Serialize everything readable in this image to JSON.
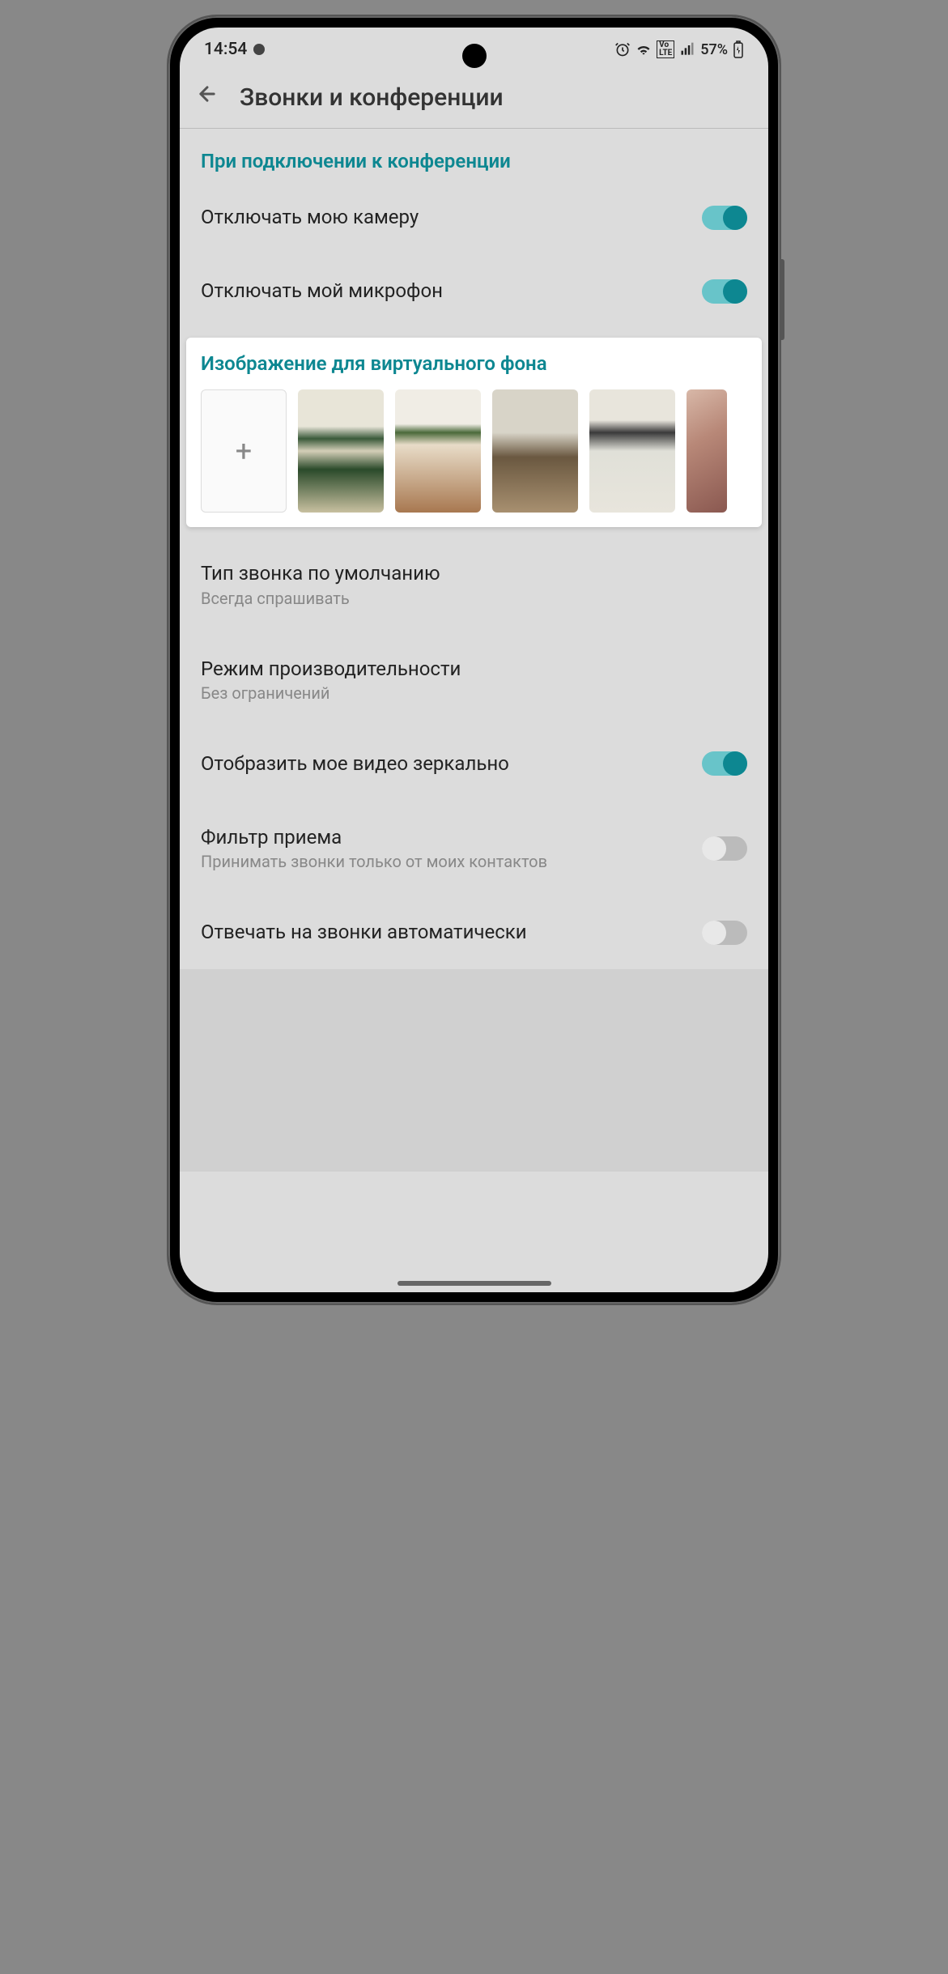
{
  "status": {
    "time": "14:54",
    "battery": "57%",
    "icons": {
      "alarm": "⏰",
      "wifi": "📶",
      "volte": "VoLTE",
      "signal": "📶",
      "battery_icon": "🔋"
    }
  },
  "header": {
    "title": "Звонки и конференции"
  },
  "section1": {
    "title": "При подключении к конференции"
  },
  "settings": {
    "camera_off": {
      "label": "Отключать мою камеру",
      "on": true
    },
    "mic_off": {
      "label": "Отключать мой микрофон",
      "on": true
    },
    "default_call": {
      "label": "Тип звонка по умолчанию",
      "sub": "Всегда спрашивать"
    },
    "performance": {
      "label": "Режим производительности",
      "sub": "Без ограничений"
    },
    "mirror": {
      "label": "Отобразить мое видео зеркально",
      "on": true
    },
    "filter": {
      "label": "Фильтр приема",
      "sub": "Принимать звонки только от моих контактов",
      "on": false
    },
    "auto_answer": {
      "label": "Отвечать на звонки автоматически",
      "on": false
    }
  },
  "bg_card": {
    "title": "Изображение для виртуального фона",
    "add_label": "+",
    "thumbs": [
      "room-shelves",
      "room-plants",
      "office-table",
      "office-chairs",
      "abstract-wall"
    ]
  }
}
